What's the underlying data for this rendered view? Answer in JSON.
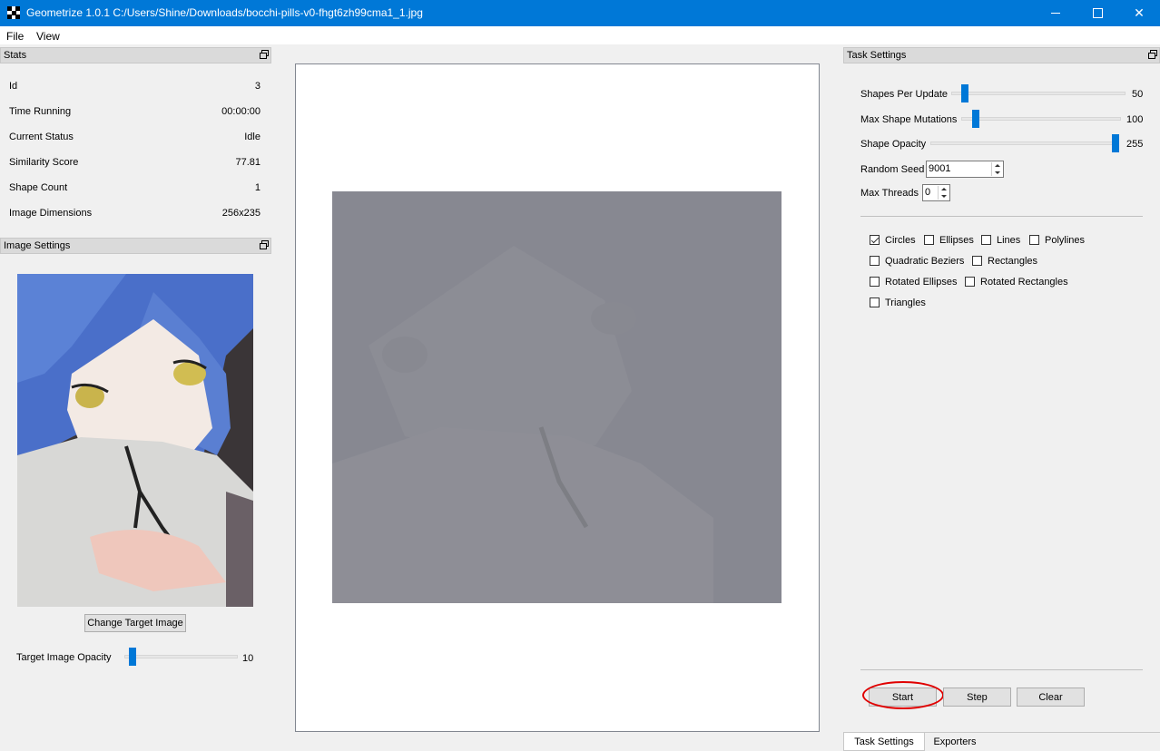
{
  "window": {
    "title": "Geometrize 1.0.1 C:/Users/Shine/Downloads/bocchi-pills-v0-fhgt6zh99cma1_1.jpg",
    "controls": [
      "minimize-icon",
      "maximize-icon",
      "close-icon"
    ]
  },
  "menu": [
    "File",
    "View"
  ],
  "stats": {
    "header": "Stats",
    "rows": [
      {
        "label": "Id",
        "value": "3"
      },
      {
        "label": "Time Running",
        "value": "00:00:00"
      },
      {
        "label": "Current Status",
        "value": "Idle"
      },
      {
        "label": "Similarity Score",
        "value": "77.81"
      },
      {
        "label": "Shape Count",
        "value": "1"
      },
      {
        "label": "Image Dimensions",
        "value": "256x235"
      }
    ]
  },
  "image_settings": {
    "header": "Image Settings",
    "change_button": "Change Target Image",
    "opacity_label": "Target Image Opacity",
    "opacity_value": "10",
    "opacity_fraction": 0.04
  },
  "task_settings": {
    "header": "Task Settings",
    "sliders": [
      {
        "label": "Shapes Per Update",
        "value": "50",
        "fraction": 0.06
      },
      {
        "label": "Max Shape Mutations",
        "value": "100",
        "fraction": 0.07
      },
      {
        "label": "Shape Opacity",
        "value": "255",
        "fraction": 1.0
      }
    ],
    "random_seed": {
      "label": "Random Seed",
      "value": "9001"
    },
    "max_threads": {
      "label": "Max Threads",
      "value": "0"
    },
    "shapes": [
      {
        "label": "Circles",
        "checked": true
      },
      {
        "label": "Ellipses",
        "checked": false
      },
      {
        "label": "Lines",
        "checked": false
      },
      {
        "label": "Polylines",
        "checked": false
      },
      {
        "label": "Quadratic Beziers",
        "checked": false
      },
      {
        "label": "Rectangles",
        "checked": false
      },
      {
        "label": "Rotated Ellipses",
        "checked": false
      },
      {
        "label": "Rotated Rectangles",
        "checked": false
      },
      {
        "label": "Triangles",
        "checked": false
      }
    ],
    "buttons": {
      "start": "Start",
      "step": "Step",
      "clear": "Clear"
    }
  },
  "bottom_tabs": [
    "Task Settings",
    "Exporters"
  ],
  "colors": {
    "accent": "#0078d7",
    "canvas_fill": "#878891",
    "highlight_ring": "#e00000"
  }
}
